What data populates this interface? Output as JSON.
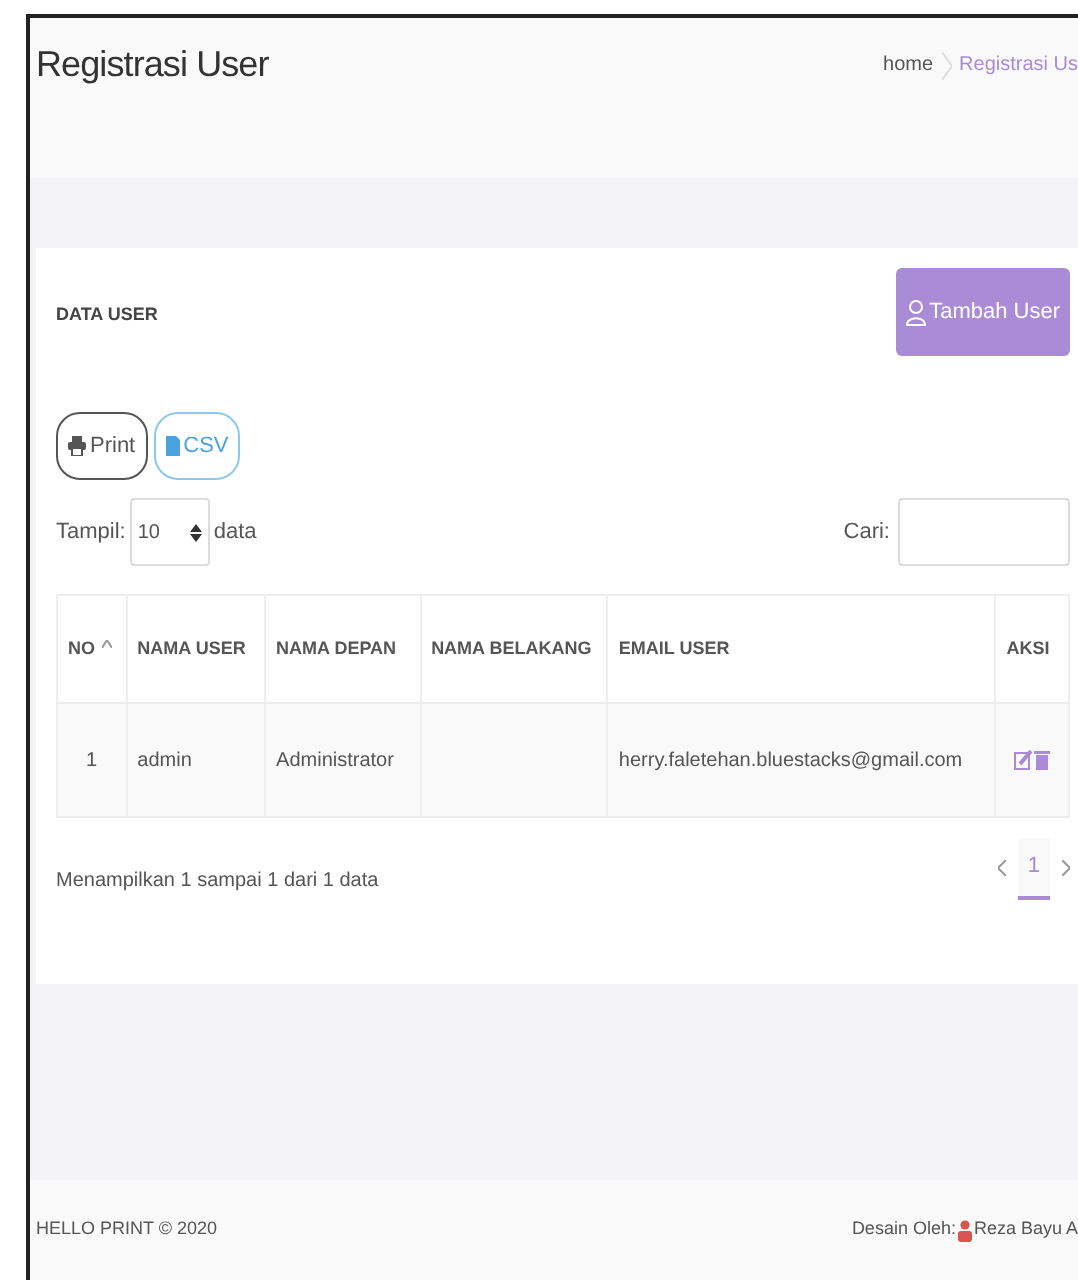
{
  "page_title": "Registrasi User",
  "breadcrumb": [
    {
      "label": "home",
      "selected": false
    },
    {
      "label": "Registrasi Us",
      "selected": true
    }
  ],
  "card": {
    "title": "DATA USER",
    "add_button": "Tambah User",
    "export_buttons": [
      {
        "label": "Print",
        "kind": "print"
      },
      {
        "label": "CSV",
        "kind": "csv"
      }
    ],
    "length": {
      "label": "Tampil:",
      "value": "10",
      "suffix": "data"
    },
    "search": {
      "label": "Cari:"
    },
    "table": {
      "columns": [
        {
          "label": "NO",
          "sorted": true
        },
        {
          "label": "NAMA USER",
          "sorted": false
        },
        {
          "label": "NAMA DEPAN",
          "sorted": false
        },
        {
          "label": "NAMA BELAKANG",
          "sorted": false
        },
        {
          "label": "EMAIL USER",
          "sorted": false
        },
        {
          "label": "AKSI",
          "sorted": false
        }
      ],
      "rows": [
        {
          "cells": [
            "1",
            "admin",
            "Administrator",
            "",
            "herry.faletehan.bluestacks@gmail.com"
          ]
        }
      ]
    },
    "info": "Menampilkan 1 sampai 1 dari 1 data",
    "pages": [
      {
        "label": "1",
        "selected": true
      }
    ]
  },
  "footer": {
    "left": "HELLO PRINT © 2020",
    "credit_label": "Desain Oleh:",
    "credit_name": "Reza Bayu A"
  }
}
